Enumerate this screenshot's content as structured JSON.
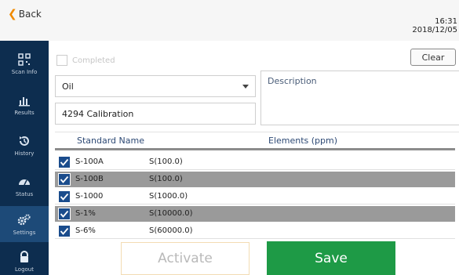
{
  "header": {
    "back_label": "Back",
    "time": "16:31",
    "date": "2018/12/05"
  },
  "sidebar": {
    "items": [
      {
        "label": "Scan Info",
        "icon": "qr-icon"
      },
      {
        "label": "Results",
        "icon": "bar-chart-icon"
      },
      {
        "label": "History",
        "icon": "history-icon"
      },
      {
        "label": "Status",
        "icon": "gauge-icon"
      },
      {
        "label": "Settings",
        "icon": "gears-icon",
        "active": true
      },
      {
        "label": "Logout",
        "icon": "lock-icon"
      }
    ]
  },
  "form": {
    "completed_label": "Completed",
    "clear_label": "Clear",
    "matrix_value": "Oil",
    "description_label": "Description",
    "calibration_name": "4294 Calibration"
  },
  "table": {
    "headers": {
      "standard_name": "Standard Name",
      "elements": "Elements (ppm)"
    },
    "rows": [
      {
        "name": "S-100A",
        "elements": "S(100.0)",
        "checked": true
      },
      {
        "name": "S-100B",
        "elements": "S(100.0)",
        "checked": true
      },
      {
        "name": "S-1000",
        "elements": "S(1000.0)",
        "checked": true
      },
      {
        "name": "S-1%",
        "elements": "S(10000.0)",
        "checked": true
      },
      {
        "name": "S-6%",
        "elements": "S(60000.0)",
        "checked": true
      }
    ]
  },
  "actions": {
    "activate_label": "Activate",
    "save_label": "Save"
  },
  "colors": {
    "sidebar": "#0d2d4f",
    "save": "#1e9a46",
    "back_chevron": "#f08a00",
    "checkbox": "#1a4c8c"
  }
}
